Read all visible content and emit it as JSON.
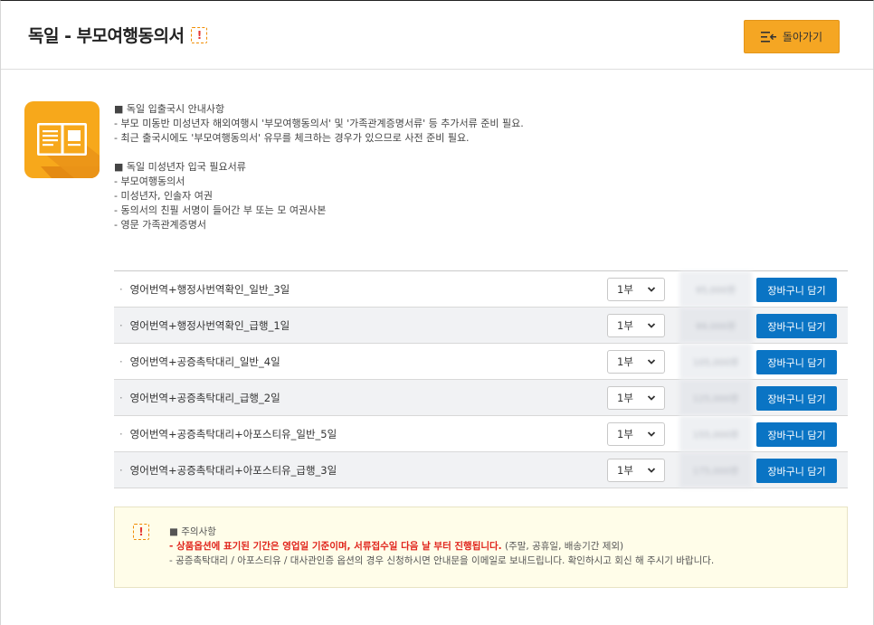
{
  "header": {
    "title": "독일 - 부모여행동의서",
    "warn_glyph": "!",
    "back_label": "돌아가기"
  },
  "info": {
    "section1_title": "■ 독일 입출국시 안내사항",
    "section1_lines": [
      "- 부모 미동반 미성년자 해외여행시 '부모여행동의서' 및 '가족관계증명서류' 등 추가서류 준비 필요.",
      "- 최근 출국시에도 '부모여행동의서' 유무를 체크하는 경우가 있으므로 사전 준비 필요."
    ],
    "section2_title": "■ 독일 미성년자 입국 필요서류",
    "section2_lines": [
      "- 부모여행동의서",
      "- 미성년자, 인솔자 여권",
      "- 동의서의 친필 서명이 들어간 부 또는 모 여권사본",
      "- 영문 가족관계증명서"
    ]
  },
  "products": [
    {
      "name": "영어번역+행정사번역확인_일반_3일",
      "qty": "1부",
      "price": "95,000원",
      "cart_label": "장바구니 담기"
    },
    {
      "name": "영어번역+행정사번역확인_급행_1일",
      "qty": "1부",
      "price": "99,000원",
      "cart_label": "장바구니 담기"
    },
    {
      "name": "영어번역+공증촉탁대리_일반_4일",
      "qty": "1부",
      "price": "105,000원",
      "cart_label": "장바구니 담기"
    },
    {
      "name": "영어번역+공증촉탁대리_급행_2일",
      "qty": "1부",
      "price": "125,000원",
      "cart_label": "장바구니 담기"
    },
    {
      "name": "영어번역+공증촉탁대리+아포스티유_일반_5일",
      "qty": "1부",
      "price": "155,000원",
      "cart_label": "장바구니 담기"
    },
    {
      "name": "영어번역+공증촉탁대리+아포스티유_급행_3일",
      "qty": "1부",
      "price": "175,000원",
      "cart_label": "장바구니 담기"
    }
  ],
  "notice": {
    "glyph": "!",
    "title": "■ 주의사항",
    "red_text": "- 상품옵션에 표기된 기간은 영업일 기준이며, 서류접수일 다음 날 부터 진행됩니다.",
    "red_suffix": " (주말, 공휴일, 배송기간 제외)",
    "line2": "- 공증촉탁대리 / 아포스티유 / 대사관인증 옵션의 경우 신청하시면 안내문을 이메일로 보내드립니다. 확인하시고 회신 해 주시기 바랍니다."
  },
  "colors": {
    "accent_orange": "#f5a623",
    "cart_blue": "#0a74c4",
    "alert_red": "#e0241b"
  },
  "icons": {
    "back": "list-back-icon",
    "book": "open-book-icon",
    "chevron": "chevron-down-icon",
    "warning": "warning-icon"
  }
}
